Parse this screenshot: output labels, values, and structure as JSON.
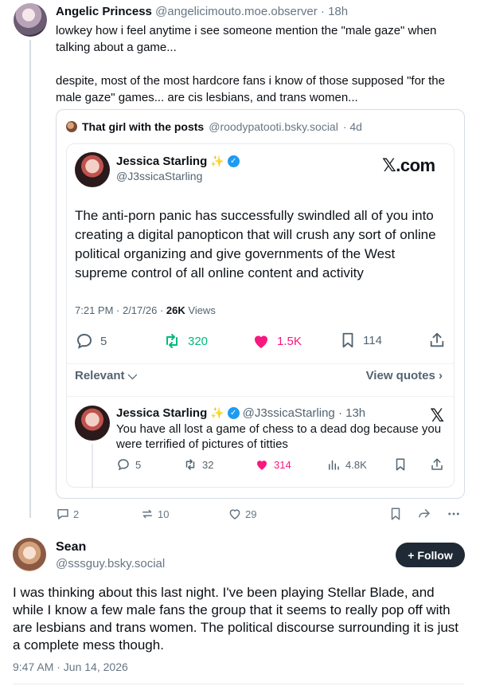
{
  "post1": {
    "author_name": "Angelic Princess",
    "author_handle": "@angelicimouto.moe.observer",
    "time_sep": " · ",
    "time": "18h",
    "paragraph1": "lowkey how i feel anytime i see someone mention the \"male gaze\" when talking about a game...",
    "paragraph2": "despite, most of the most hardcore fans i know of those supposed \"for the male gaze\" games... are cis lesbians, and trans women...",
    "quote": {
      "author_name": "That girl with the posts",
      "author_handle": "@roodypatooti.bsky.social",
      "time": "· 4d",
      "embed": {
        "name": "Jessica Starling",
        "sparkle": "✨",
        "handle": "@J3ssicaStarling",
        "logo": "𝕏.com",
        "body": "The anti-porn panic has successfully swindled all of you into creating a digital panopticon that will crush any sort of online political organizing and give governments of the West supreme control of all online content and activity",
        "meta_time": "7:21 PM · 2/17/26 · ",
        "meta_views_count": "26K",
        "meta_views_label": " Views",
        "replies": "5",
        "reposts": "320",
        "likes": "1.5K",
        "bookmarks": "114",
        "relevant_label": "Relevant",
        "view_quotes_label": "View quotes",
        "reply": {
          "name": "Jessica Starling",
          "sparkle": "✨",
          "handle_time": "@J3ssicaStarling · 13h",
          "text": "You have all lost a game of chess to a dead dog because you were terrified of pictures of titties",
          "replies": "5",
          "reposts": "32",
          "likes": "314",
          "views": "4.8K"
        }
      }
    },
    "actions": {
      "replies": "2",
      "reposts": "10",
      "likes": "29"
    }
  },
  "post2": {
    "author_name": "Sean",
    "author_handle": "@sssguy.bsky.social",
    "follow_label": "Follow",
    "text": "I was thinking about this last night. I've been playing Stellar Blade, and while I know a few male fans the group that it seems to really pop off with are lesbians and trans women. The political discourse surrounding it is just a complete mess though.",
    "timestamp": "9:47 AM · Jun 14, 2026"
  },
  "colors": {
    "like_pink": "#f91880",
    "repost_green": "#00ba7c",
    "verified_blue": "#1d9bf0",
    "follow_bg": "#1f2a36",
    "muted": "#687684"
  },
  "icons": [
    "reply-icon",
    "repost-icon",
    "heart-icon",
    "bookmark-icon",
    "share-icon",
    "x-logo-icon",
    "views-icon",
    "more-icon",
    "verified-badge-icon",
    "plus-icon"
  ]
}
